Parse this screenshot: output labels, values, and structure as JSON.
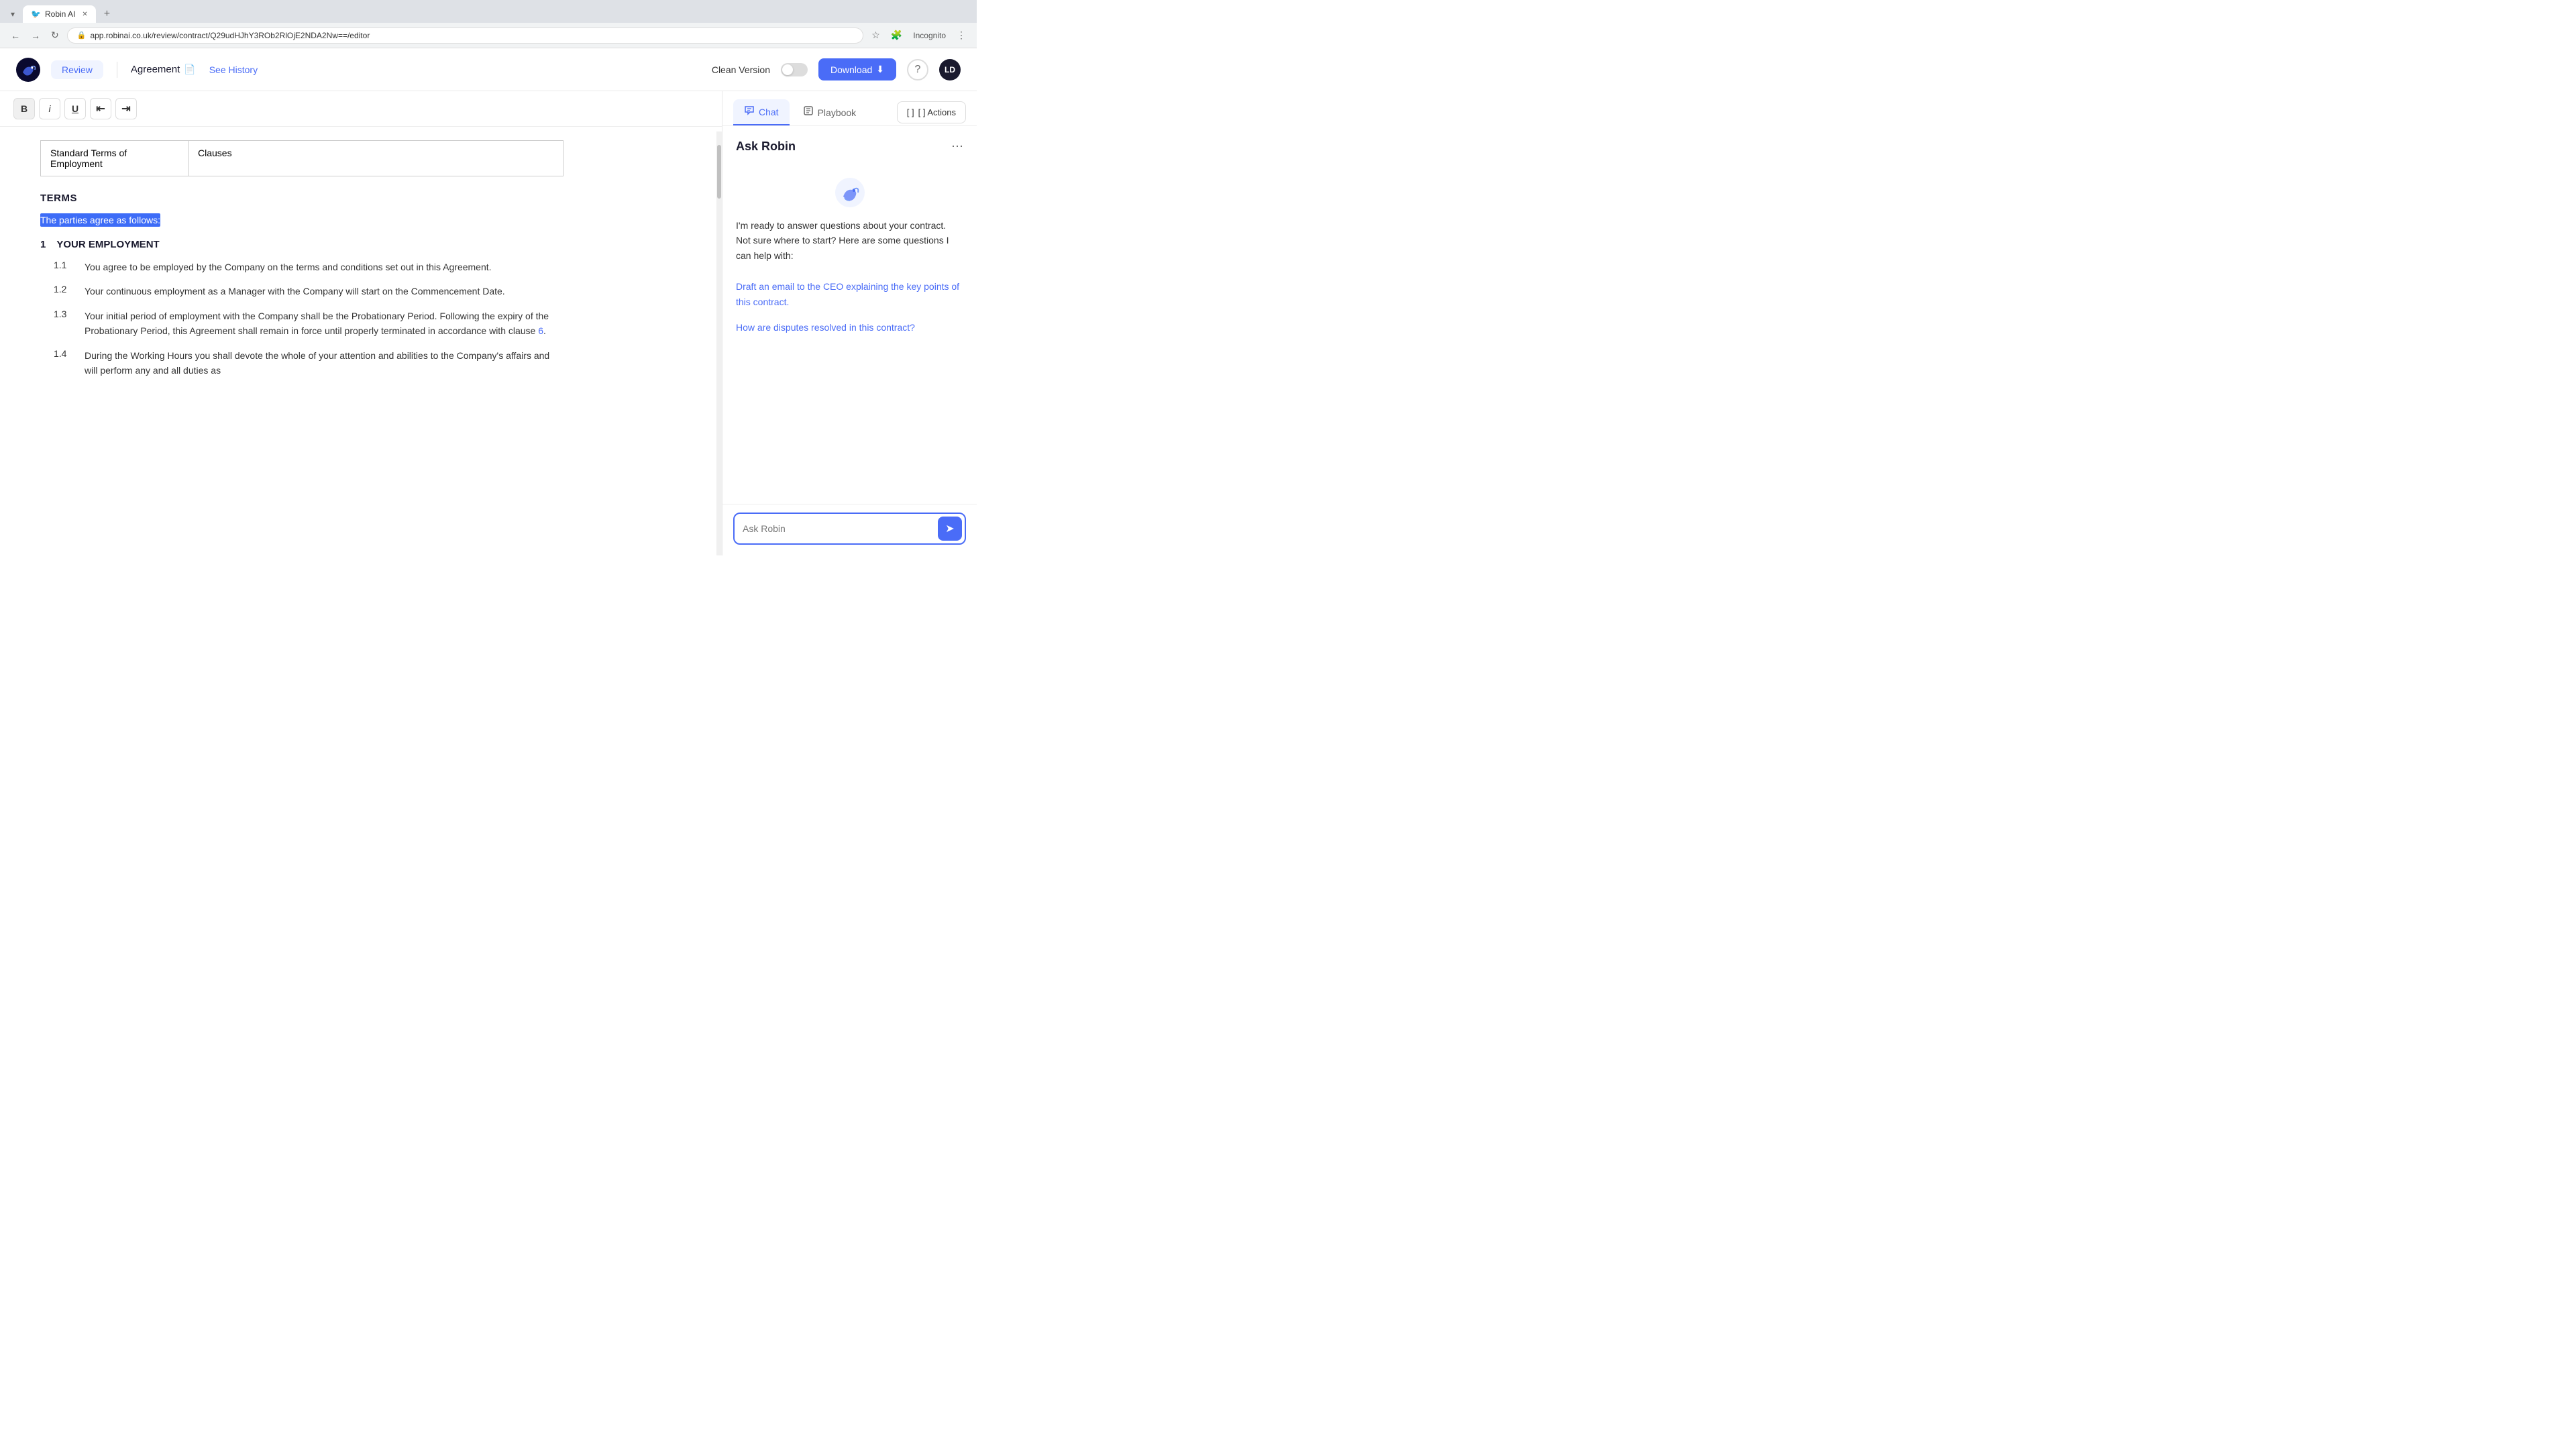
{
  "browser": {
    "tab_title": "Robin AI",
    "url": "app.robinai.co.uk/review/contract/Q29udHJhY3ROb2RlOjE2NDA2Nw==/editor",
    "incognito_label": "Incognito"
  },
  "header": {
    "review_label": "Review",
    "doc_title": "Agreement",
    "see_history_label": "See History",
    "clean_version_label": "Clean Version",
    "download_label": "Download",
    "avatar_label": "LD"
  },
  "toolbar": {
    "bold_label": "B",
    "italic_label": "i",
    "underline_label": "U",
    "indent_decrease": "⇤",
    "indent_increase": "⇥"
  },
  "editor": {
    "table_rows": [
      {
        "col1": "Standard Terms of Employment",
        "col2": "Clauses"
      }
    ],
    "terms_heading": "TERMS",
    "highlighted_text": "The parties agree as follows:",
    "sections": [
      {
        "number": "1",
        "title": "YOUR EMPLOYMENT",
        "items": [
          {
            "num": "1.1",
            "text": "You agree to be employed by the Company on the terms and conditions set out in this Agreement."
          },
          {
            "num": "1.2",
            "text": "Your continuous employment as a Manager with the Company will start on the Commencement Date."
          },
          {
            "num": "1.3",
            "text": "Your initial period of employment with the Company shall be the Probationary Period. Following the expiry of the Probationary Period, this Agreement shall remain in force until properly terminated in accordance with clause 6.",
            "clause_link": "6",
            "clause_link_pos": "with clause "
          },
          {
            "num": "1.4",
            "text": "During the Working Hours you shall devote the whole of your attention and abilities to the Company's affairs and will perform any and all duties as"
          }
        ]
      }
    ]
  },
  "sidebar": {
    "chat_tab_label": "Chat",
    "playbook_tab_label": "Playbook",
    "actions_tab_label": "[ ] Actions",
    "ask_robin_title": "Ask Robin",
    "robin_intro_line1": "I'm ready to answer questions about your contract.",
    "robin_intro_line2": "Not sure where to start? Here are some questions I can help with:",
    "suggested_q1": "Draft an email to the CEO explaining the key points of this contract.",
    "suggested_q2": "How are disputes resolved in this contract?",
    "ask_placeholder": "Ask Robin"
  },
  "colors": {
    "accent": "#4a6cf7",
    "highlight_bg": "#3d6cf7",
    "header_bg": "#ffffff",
    "sidebar_bg": "#ffffff"
  }
}
